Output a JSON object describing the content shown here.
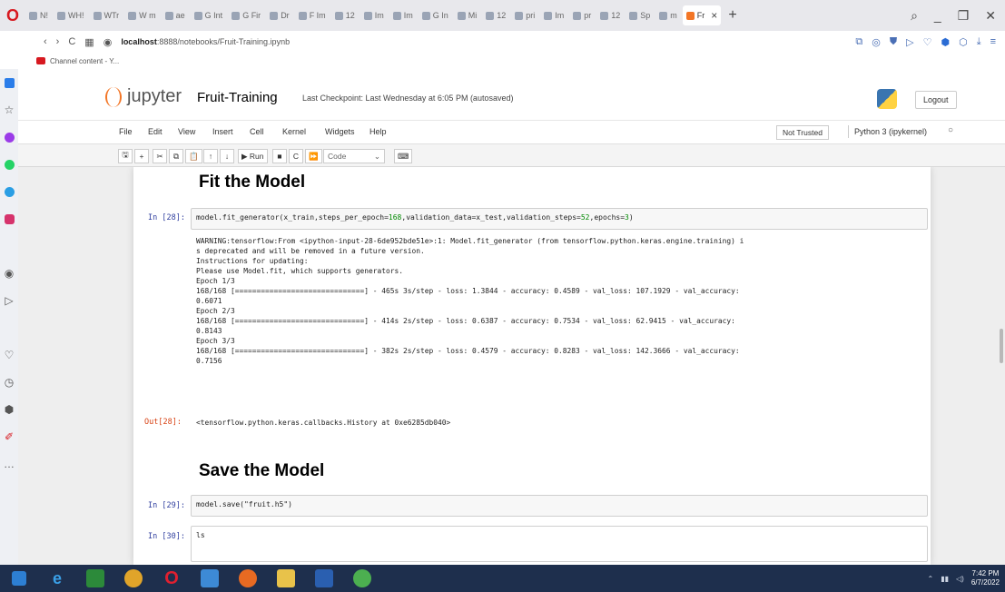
{
  "browser": {
    "tabs": [
      {
        "label": "N!"
      },
      {
        "label": "WH!"
      },
      {
        "label": "WTr"
      },
      {
        "label": "W m"
      },
      {
        "label": "ae"
      },
      {
        "label": "G Int"
      },
      {
        "label": "G Fir"
      },
      {
        "label": "Dr"
      },
      {
        "label": "F Im"
      },
      {
        "label": "12"
      },
      {
        "label": "Im"
      },
      {
        "label": "Im"
      },
      {
        "label": "G In"
      },
      {
        "label": "Mi"
      },
      {
        "label": "12"
      },
      {
        "label": "pri"
      },
      {
        "label": "Im"
      },
      {
        "label": "pr"
      },
      {
        "label": "12"
      },
      {
        "label": "Sp"
      },
      {
        "label": "m"
      }
    ],
    "active_tab": {
      "label": "Fr"
    },
    "url_host": "localhost",
    "url_path": ":8888/notebooks/Fruit-Training.ipynb",
    "bookmark_label": "Channel content - Y..."
  },
  "jupyter": {
    "logo_text": "jupyter",
    "notebook_title": "Fruit-Training",
    "checkpoint": "Last Checkpoint: Last Wednesday at 6:05 PM  (autosaved)",
    "logout_label": "Logout",
    "menu": [
      "File",
      "Edit",
      "View",
      "Insert",
      "Cell",
      "Kernel",
      "Widgets",
      "Help"
    ],
    "trust_label": "Not Trusted",
    "kernel_name": "Python 3 (ipykernel)",
    "toolbar": {
      "run_label": "Run",
      "cell_type": "Code"
    }
  },
  "notebook": {
    "heading1": "Fit the Model",
    "cell28_prompt": "In [28]:",
    "cell28_code_a": "model.fit_generator(x_train,steps_per_epoch=",
    "cell28_code_num1": "168",
    "cell28_code_b": ",validation_data=x_test,validation_steps=",
    "cell28_code_num2": "52",
    "cell28_code_c": ",epochs=",
    "cell28_code_num3": "3",
    "cell28_code_d": ")",
    "cell28_output": "WARNING:tensorflow:From <ipython-input-28-6de952bde51e>:1: Model.fit_generator (from tensorflow.python.keras.engine.training) i\ns deprecated and will be removed in a future version.\nInstructions for updating:\nPlease use Model.fit, which supports generators.\nEpoch 1/3\n168/168 [==============================] - 465s 3s/step - loss: 1.3844 - accuracy: 0.4589 - val_loss: 107.1929 - val_accuracy:\n0.6071\nEpoch 2/3\n168/168 [==============================] - 414s 2s/step - loss: 0.6387 - accuracy: 0.7534 - val_loss: 62.9415 - val_accuracy:\n0.8143\nEpoch 3/3\n168/168 [==============================] - 382s 2s/step - loss: 0.4579 - accuracy: 0.8283 - val_loss: 142.3666 - val_accuracy:\n0.7156",
    "out28_prompt": "Out[28]:",
    "out28_value": "<tensorflow.python.keras.callbacks.History at 0xe6285db040>",
    "heading2": "Save the Model",
    "cell29_prompt": "In [29]:",
    "cell29_code": "model.save(\"fruit.h5\")",
    "cell30_prompt": "In [30]:",
    "cell30_code": "ls"
  },
  "taskbar": {
    "clock_time": "7:42 PM",
    "clock_date": "6/7/2022"
  }
}
